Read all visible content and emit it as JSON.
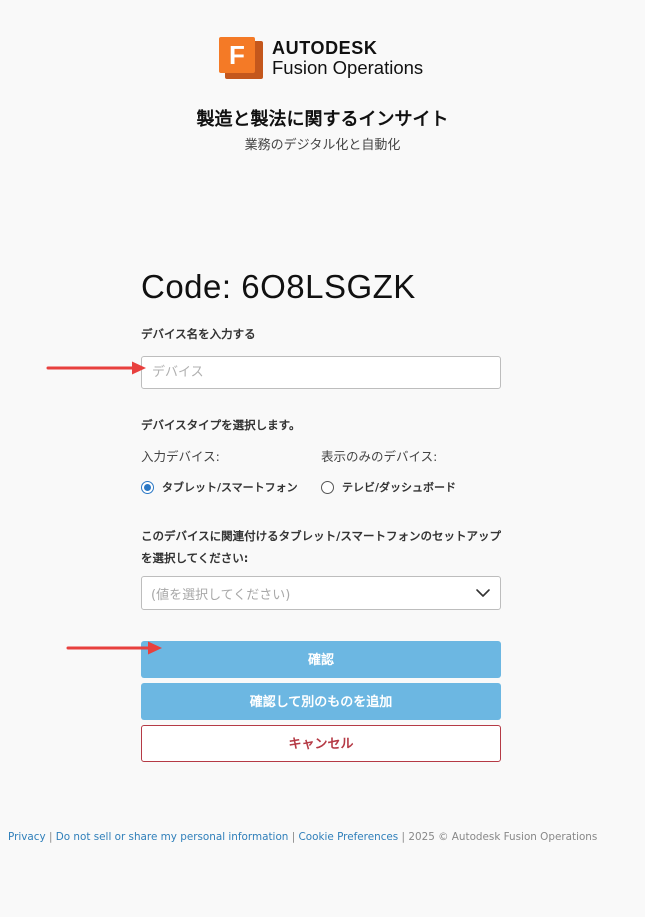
{
  "brand": {
    "logo_letter": "F",
    "company": "AUTODESK",
    "product": "Fusion Operations"
  },
  "headline": "製造と製法に関するインサイト",
  "subheadline": "業務のデジタル化と自動化",
  "form": {
    "code_text": "Code: 6O8LSGZK",
    "device_name_label": "デバイス名を入力する",
    "device_name_placeholder": "デバイス",
    "device_name_value": "",
    "device_type_label": "デバイスタイプを選択します。",
    "input_device_title": "入力デバイス:",
    "display_device_title": "表示のみのデバイス:",
    "option_tablet": "タブレット/スマートフォン",
    "option_tv": "テレビ/ダッシュボード",
    "selected_type": "tablet",
    "setup_label": "このデバイスに関連付けるタブレット/スマートフォンのセットアップを選択してください:",
    "setup_placeholder": "(値を選択してください)"
  },
  "buttons": {
    "confirm": "確認",
    "confirm_add": "確認して別のものを追加",
    "cancel": "キャンセル"
  },
  "footer": {
    "privacy": "Privacy",
    "do_not_sell": "Do not sell or share my personal information",
    "cookie": "Cookie Preferences",
    "separator": "|",
    "copyright": "2025 © Autodesk Fusion Operations"
  },
  "colors": {
    "accent_button": "#6cb7e2",
    "cancel_border": "#b53a45",
    "annotation_arrow": "#e8403e",
    "logo_orange": "#f47a26"
  }
}
